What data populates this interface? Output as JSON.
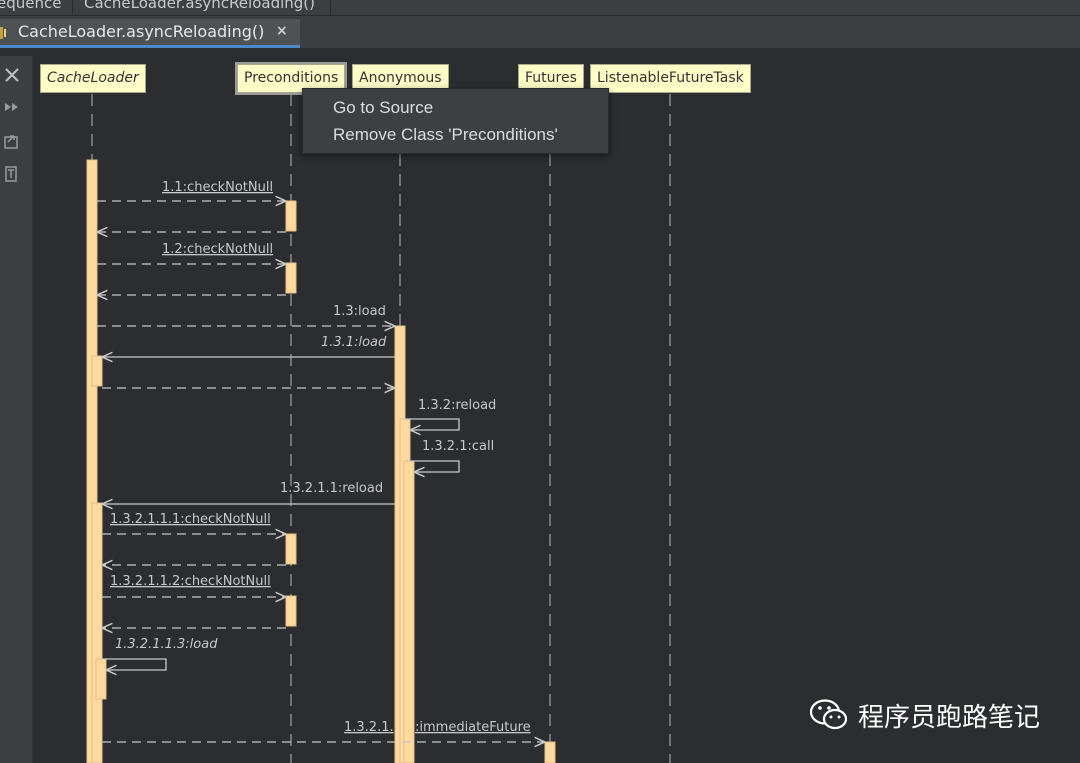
{
  "topbar": {
    "crumb_1": "equence",
    "crumb_2": "CacheLoader.asyncReloading()"
  },
  "editor_tab": {
    "label": "CacheLoader.asyncReloading()",
    "close_glyph": "×"
  },
  "toolbar": {
    "icons": [
      "close-icon",
      "fast-forward-icon",
      "export-diagram-icon",
      "toggle-topic-icon"
    ]
  },
  "lifelines": [
    {
      "id": "cacheloader",
      "label": "CacheLoader",
      "italic": true
    },
    {
      "id": "preconditions",
      "label": "Preconditions",
      "italic": false,
      "selected": true
    },
    {
      "id": "anonymous",
      "label": "Anonymous",
      "italic": false
    },
    {
      "id": "futures",
      "label": "Futures",
      "italic": false
    },
    {
      "id": "listenablefuturetask",
      "label": "ListenableFutureTask",
      "italic": false
    }
  ],
  "messages": [
    {
      "label": "1.1:checkNotNull",
      "underlined": true
    },
    {
      "label": "1.2:checkNotNull",
      "underlined": true
    },
    {
      "label": "1.3:load"
    },
    {
      "label": "1.3.1:load",
      "italic": true
    },
    {
      "label": "1.3.2:reload"
    },
    {
      "label": "1.3.2.1:call"
    },
    {
      "label": "1.3.2.1.1:reload"
    },
    {
      "label": "1.3.2.1.1.1:checkNotNull",
      "underlined": true
    },
    {
      "label": "1.3.2.1.1.2:checkNotNull",
      "underlined": true
    },
    {
      "label": "1.3.2.1.1.3:load",
      "italic": true
    },
    {
      "label": "1.3.2.1.1.4:immediateFuture",
      "partial_prefix": "1.3.2.1.",
      "partial_suffix": ":immediateFuture",
      "underlined": true
    }
  ],
  "context_menu": {
    "items": [
      {
        "label": "Go to Source"
      },
      {
        "label": "Remove Class 'Preconditions'"
      }
    ]
  },
  "watermark": {
    "text": "程序员跑路笔记",
    "icon": "wechat-icon"
  },
  "colors": {
    "background": "#2b2d30",
    "activation": "#fdd9a0",
    "lifeline_head": "#fefdc8",
    "arrow": "#c8c8c8"
  }
}
